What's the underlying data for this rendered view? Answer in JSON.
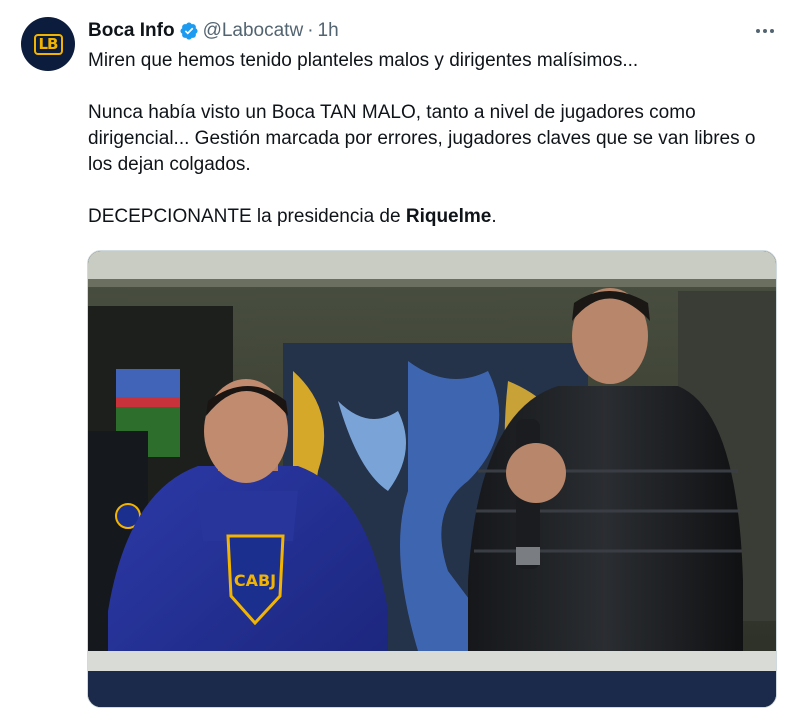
{
  "author": {
    "display_name": "Boca Info",
    "handle": "@Labocatw",
    "separator": "·",
    "time": "1h",
    "avatar_text": "LB"
  },
  "tweet": {
    "line1": "Miren que hemos tenido planteles malos y dirigentes malísimos...",
    "line2": "Nunca había visto un Boca TAN MALO, tanto a nivel de jugadores como dirigencial... Gestión marcada por errores, jugadores claves que se van libres o los dejan colgados.",
    "line3_prefix": "DECEPCIONANTE la presidencia de ",
    "line3_bold": "Riquelme",
    "line3_suffix": "."
  },
  "photo": {
    "shirt_text": "CABJ"
  },
  "colors": {
    "verified": "#1d9bf0",
    "avatar_bg": "#0c1c3d",
    "avatar_accent": "#f2b400",
    "secondary_text": "#536471",
    "boca_blue": "#1b2f8f",
    "boca_gold": "#f2b400"
  },
  "icons": {
    "verified": "verified-badge-icon",
    "more": "more-options-icon"
  }
}
